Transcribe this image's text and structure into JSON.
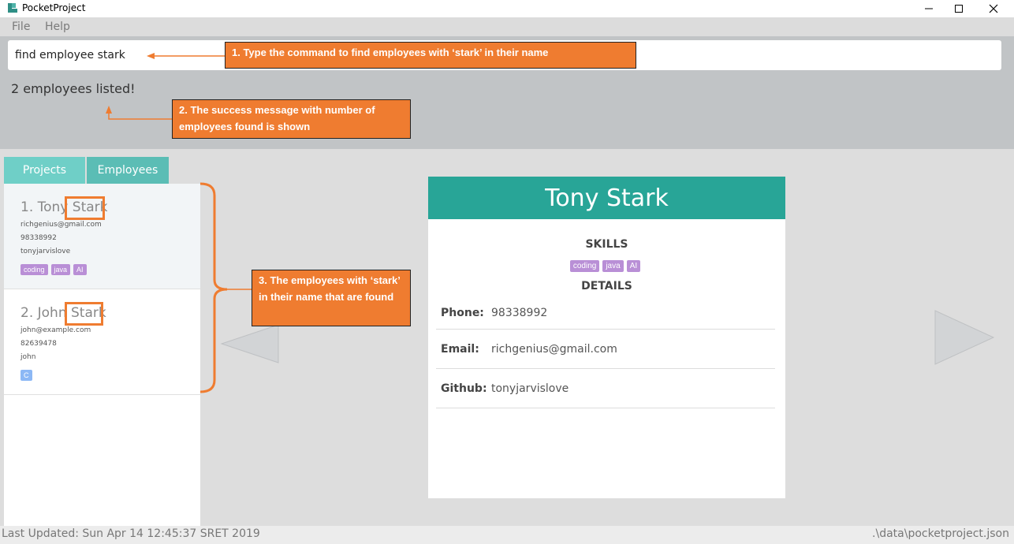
{
  "window": {
    "title": "PocketProject",
    "controls": [
      "minimize-icon",
      "maximize-icon",
      "close-icon"
    ]
  },
  "menu": {
    "file": "File",
    "help": "Help"
  },
  "command": {
    "value": "find employee stark"
  },
  "result": {
    "message": "2 employees listed!"
  },
  "tabs": [
    {
      "label": "Projects",
      "active": false
    },
    {
      "label": "Employees",
      "active": true
    }
  ],
  "employees": [
    {
      "index": "1.",
      "first": "Tony",
      "last": "Stark",
      "email": "richgenius@gmail.com",
      "phone": "98338992",
      "github": "tonyjarvislove",
      "tags": [
        "coding",
        "java",
        "AI"
      ]
    },
    {
      "index": "2.",
      "first": "John",
      "last": "Stark",
      "email": "john@example.com",
      "phone": "82639478",
      "github": "john",
      "tags": [
        "C"
      ]
    }
  ],
  "detail": {
    "name": "Tony Stark",
    "skills_title": "SKILLS",
    "skills": [
      "coding",
      "java",
      "AI"
    ],
    "details_title": "DETAILS",
    "phone_label": "Phone:",
    "phone": "98338992",
    "email_label": "Email:",
    "email": "richgenius@gmail.com",
    "github_label": "Github:",
    "github": "tonyjarvislove"
  },
  "status": {
    "last_updated": "Last Updated: Sun Apr 14 12:45:37 SRET 2019",
    "path": ".\\data\\pocketproject.json"
  },
  "annotations": {
    "callout1": "1. Type the command to find employees with ‘stark’ in their name",
    "callout2": "2. The success message with number of employees found is shown",
    "callout3": "3. The employees with ‘stark’ in their name that are found"
  },
  "colors": {
    "accent": "#28a597",
    "tab": "#6fcfc7",
    "annotation": "#ef7c30",
    "tag_purple": "#b98fd6",
    "tag_blue": "#8cb8f5"
  }
}
